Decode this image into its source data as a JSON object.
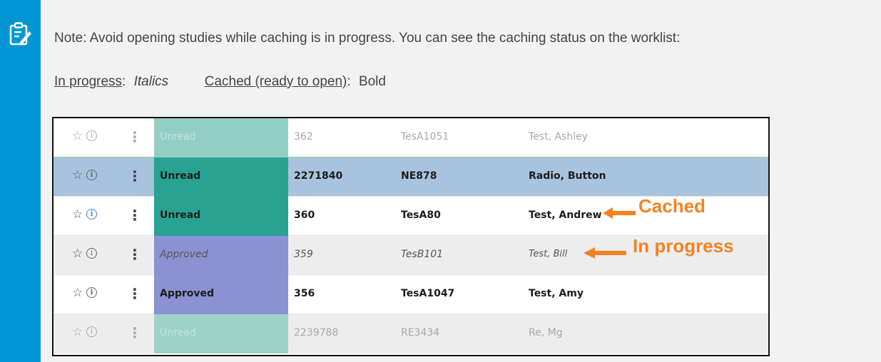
{
  "note": {
    "text": "Note: Avoid opening studies while caching is in progress. You can see the caching status on the worklist:",
    "legend": {
      "in_progress_label": "In progress",
      "colon": ":",
      "in_progress_style": "Italics",
      "cached_label": "Cached (ready to open)",
      "cached_colon": ":",
      "cached_style": "Bold"
    },
    "accent_color": "#0096d6",
    "icon": "note-edit-icon"
  },
  "worklist": {
    "rows": [
      {
        "star": "☆",
        "info": "i",
        "menu": "⋮",
        "status": "Unread",
        "id": "362",
        "code": "TesA1051",
        "name": "Test, Ashley"
      },
      {
        "star": "☆",
        "info": "i",
        "menu": "⋮",
        "status": "Unread",
        "id": "2271840",
        "code": "NE878",
        "name": "Radio, Button"
      },
      {
        "star": "☆",
        "info": "i",
        "menu": "⋮",
        "status": "Unread",
        "id": "360",
        "code": "TesA80",
        "name": "Test, Andrew"
      },
      {
        "star": "☆",
        "info": "i",
        "menu": "⋮",
        "status": "Approved",
        "id": "359",
        "code": "TesB101",
        "name": "Test, Bill"
      },
      {
        "star": "☆",
        "info": "i",
        "menu": "⋮",
        "status": "Approved",
        "id": "356",
        "code": "TesA1047",
        "name": "Test, Amy"
      },
      {
        "star": "☆",
        "info": "i",
        "menu": "⋮",
        "status": "Unread",
        "id": "2239788",
        "code": "RE3434",
        "name": "Re, Mg"
      }
    ]
  },
  "annotations": {
    "cached": "Cached",
    "in_progress": "In progress",
    "color": "#f58220"
  }
}
